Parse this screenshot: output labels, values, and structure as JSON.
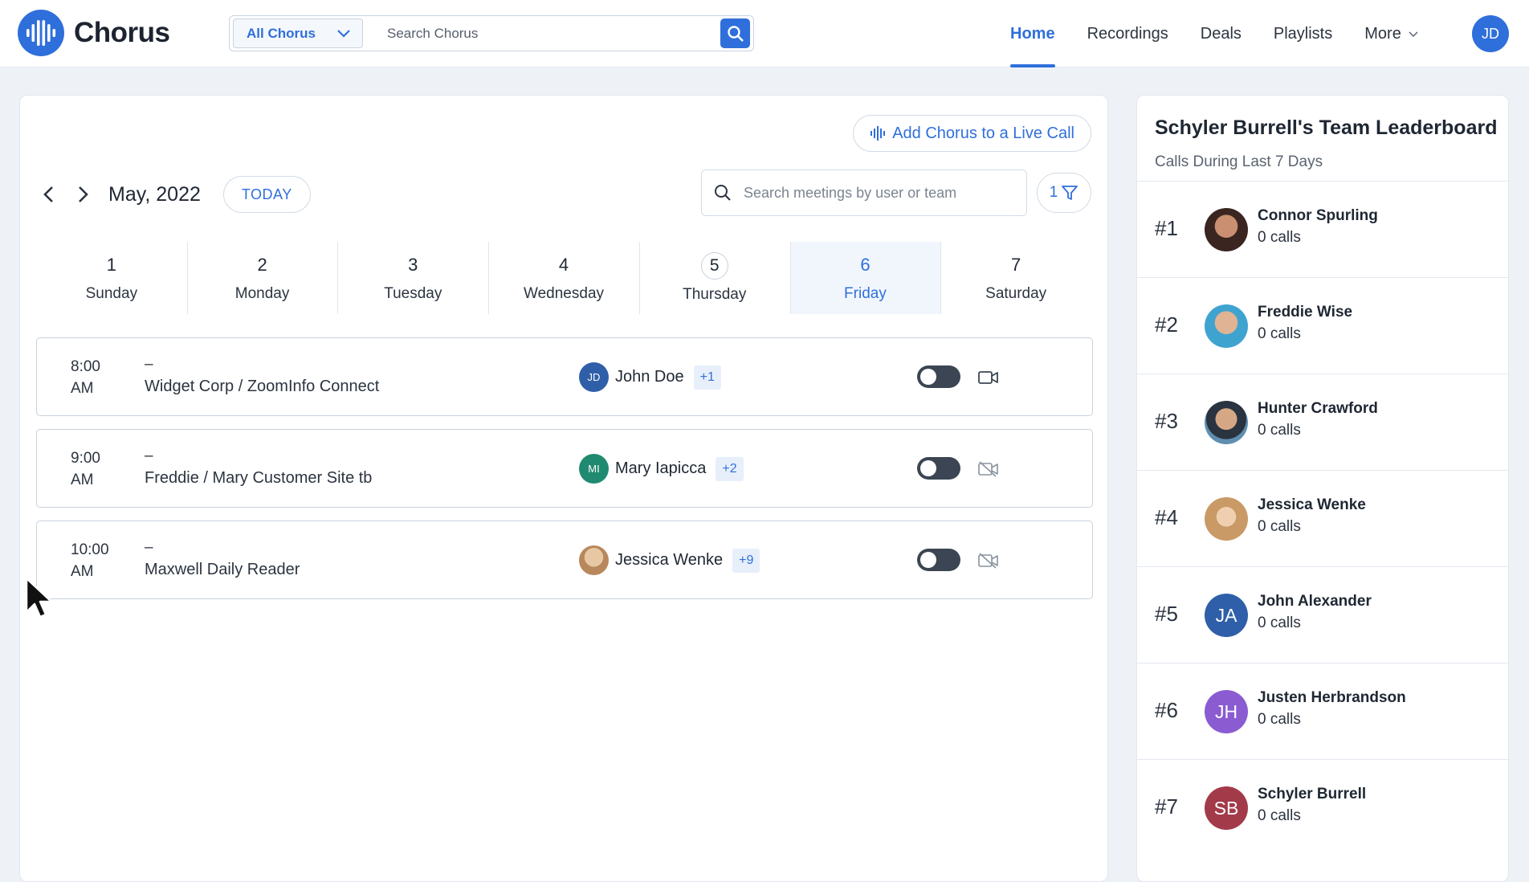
{
  "app": {
    "name": "Chorus"
  },
  "topbar": {
    "scope": "All Chorus",
    "search_placeholder": "Search Chorus",
    "nav": [
      {
        "label": "Home",
        "active": true
      },
      {
        "label": "Recordings"
      },
      {
        "label": "Deals"
      },
      {
        "label": "Playlists"
      },
      {
        "label": "More"
      }
    ],
    "user_initials": "JD"
  },
  "calendar": {
    "live_call_label": "Add Chorus to a Live Call",
    "month": "May, 2022",
    "today_label": "TODAY",
    "search_placeholder": "Search meetings by user or team",
    "filter_count": "1",
    "days": [
      {
        "num": "1",
        "name": "Sunday"
      },
      {
        "num": "2",
        "name": "Monday"
      },
      {
        "num": "3",
        "name": "Tuesday"
      },
      {
        "num": "4",
        "name": "Wednesday"
      },
      {
        "num": "5",
        "name": "Thursday",
        "today": true
      },
      {
        "num": "6",
        "name": "Friday",
        "selected": true
      },
      {
        "num": "7",
        "name": "Saturday"
      }
    ],
    "meetings": [
      {
        "time": "8:00",
        "ampm": "AM",
        "dash": "–",
        "title": "Widget Corp / ZoomInfo Connect",
        "owner": "John Doe",
        "owner_initials": "JD",
        "owner_color": "#2f5fa8",
        "extra": "+1",
        "video": true
      },
      {
        "time": "9:00",
        "ampm": "AM",
        "dash": "–",
        "title": "Freddie / Mary Customer Site tb",
        "owner": "Mary Iapicca",
        "owner_initials": "MI",
        "owner_color": "#1f8a70",
        "extra": "+2",
        "video": false
      },
      {
        "time": "10:00",
        "ampm": "AM",
        "dash": "–",
        "title": "Maxwell Daily Reader",
        "owner": "Jessica Wenke",
        "owner_initials": "",
        "owner_color": "#c9a27a",
        "extra": "+9",
        "video": false
      }
    ]
  },
  "leaderboard": {
    "title": "Schyler Burrell's Team Leaderboard",
    "subtitle": "Calls During Last 7 Days",
    "entries": [
      {
        "rank": "#1",
        "name": "Connor Spurling",
        "calls": "0 calls",
        "initials": "",
        "color": "#6b3a2e"
      },
      {
        "rank": "#2",
        "name": "Freddie Wise",
        "calls": "0 calls",
        "initials": "",
        "color": "#4aa3c9"
      },
      {
        "rank": "#3",
        "name": "Hunter Crawford",
        "calls": "0 calls",
        "initials": "",
        "color": "#4b6b85"
      },
      {
        "rank": "#4",
        "name": "Jessica Wenke",
        "calls": "0 calls",
        "initials": "",
        "color": "#d8b48a"
      },
      {
        "rank": "#5",
        "name": "John Alexander",
        "calls": "0 calls",
        "initials": "JA",
        "color": "#2f5fa8"
      },
      {
        "rank": "#6",
        "name": "Justen Herbrandson",
        "calls": "0 calls",
        "initials": "JH",
        "color": "#8a5bd1"
      },
      {
        "rank": "#7",
        "name": "Schyler Burrell",
        "calls": "0 calls",
        "initials": "SB",
        "color": "#a33a4a"
      }
    ]
  }
}
